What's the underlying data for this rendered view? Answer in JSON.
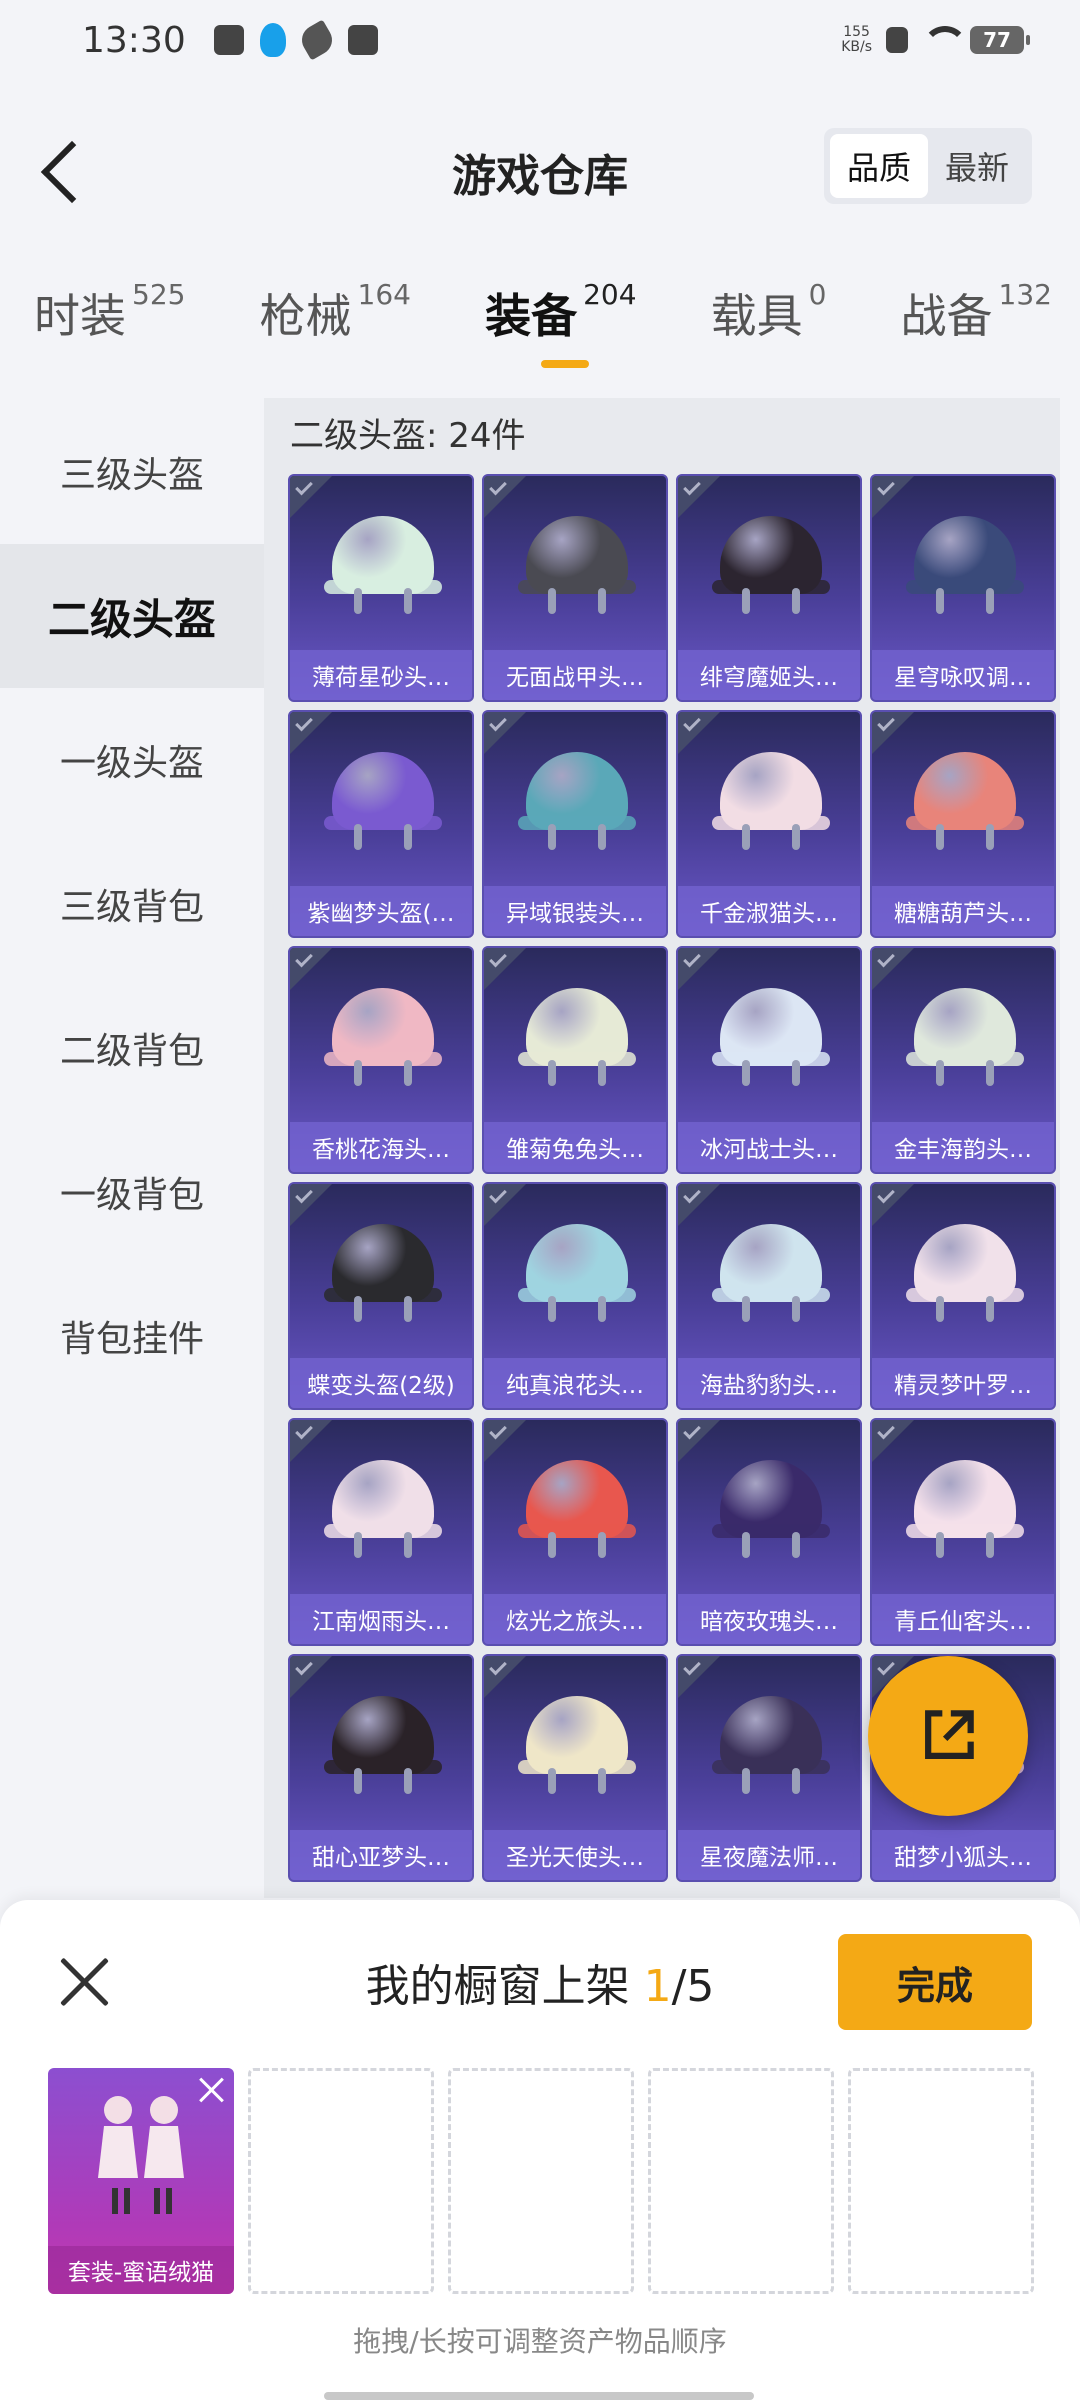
{
  "status_bar": {
    "time": "13:30",
    "speed_value": "155",
    "speed_unit": "KB/s",
    "battery": "77"
  },
  "header": {
    "title": "游戏仓库",
    "sort_quality": "品质",
    "sort_newest": "最新"
  },
  "categories": [
    {
      "label": "时装",
      "count": "525"
    },
    {
      "label": "枪械",
      "count": "164"
    },
    {
      "label": "装备",
      "count": "204"
    },
    {
      "label": "载具",
      "count": "0"
    },
    {
      "label": "战备",
      "count": "132"
    }
  ],
  "sidebar": [
    "三级头盔",
    "二级头盔",
    "一级头盔",
    "三级背包",
    "二级背包",
    "一级背包",
    "背包挂件"
  ],
  "section_title": "二级头盔: 24件",
  "items": [
    {
      "name": "薄荷星砂头…",
      "color": "#d8eee0"
    },
    {
      "name": "无面战甲头…",
      "color": "#4a4a52"
    },
    {
      "name": "绯穹魔姬头…",
      "color": "#2c2530"
    },
    {
      "name": "星穹咏叹调…",
      "color": "#3a4a7a"
    },
    {
      "name": "紫幽梦头盔(…",
      "color": "#7a5ad0"
    },
    {
      "name": "异域银装头…",
      "color": "#5aa8b8"
    },
    {
      "name": "千金淑猫头…",
      "color": "#f2dde4"
    },
    {
      "name": "糖糖葫芦头…",
      "color": "#e8847a"
    },
    {
      "name": "香桃花海头…",
      "color": "#f0b8c4"
    },
    {
      "name": "雏菊兔兔头…",
      "color": "#e6ead6"
    },
    {
      "name": "冰河战士头…",
      "color": "#dce6f4"
    },
    {
      "name": "金丰海韵头…",
      "color": "#dfe8dc"
    },
    {
      "name": "蝶变头盔(2级)",
      "color": "#2a2a2e"
    },
    {
      "name": "纯真浪花头…",
      "color": "#9fd4e0"
    },
    {
      "name": "海盐豹豹头…",
      "color": "#cfe4ee"
    },
    {
      "name": "精灵梦叶罗…",
      "color": "#f1e1ea"
    },
    {
      "name": "江南烟雨头…",
      "color": "#f0dfe8"
    },
    {
      "name": "炫光之旅头…",
      "color": "#e8574e"
    },
    {
      "name": "暗夜玫瑰头…",
      "color": "#3a2a6a"
    },
    {
      "name": "青丘仙客头…",
      "color": "#f4e0ea"
    },
    {
      "name": "甜心亚梦头…",
      "color": "#2a2228"
    },
    {
      "name": "圣光天使头…",
      "color": "#efe6c8"
    },
    {
      "name": "星夜魔法师…",
      "color": "#3a3058"
    },
    {
      "name": "甜梦小狐头…",
      "color": "#f0c8d8"
    }
  ],
  "panel": {
    "title_prefix": "我的橱窗上架 ",
    "current": "1",
    "total": "/5",
    "done_label": "完成",
    "slot_label": "套装-蜜语绒猫",
    "hint": "拖拽/长按可调整资产物品顺序"
  },
  "colors": {
    "accent": "#f4a915",
    "card_purple": "#4a3f99"
  }
}
